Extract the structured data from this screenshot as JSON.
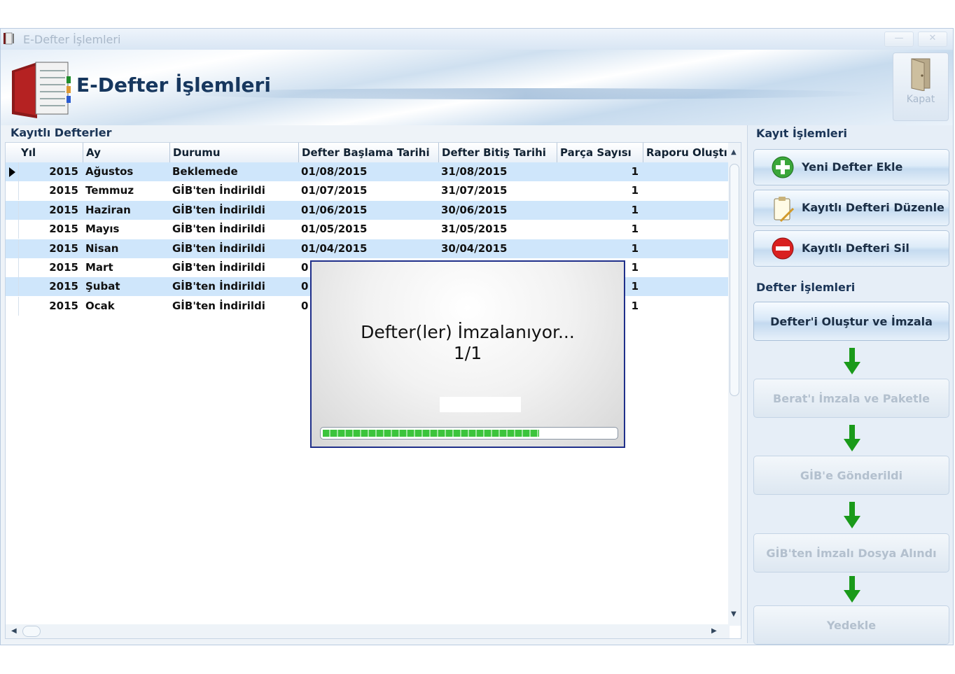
{
  "window": {
    "title": "E-Defter İşlemleri"
  },
  "banner": {
    "title": "E-Defter İşlemleri",
    "close_label": "Kapat"
  },
  "grid": {
    "section_title": "Kayıtlı Defterler",
    "columns": [
      "Yıl",
      "Ay",
      "Durumu",
      "Defter Başlama Tarihi",
      "Defter Bitiş Tarihi",
      "Parça Sayısı",
      "Raporu Oluştı"
    ],
    "rows": [
      [
        "2015",
        "Ağustos",
        "Beklemede",
        "01/08/2015",
        "31/08/2015",
        "1",
        ""
      ],
      [
        "2015",
        "Temmuz",
        "GİB'ten İndirildi",
        "01/07/2015",
        "31/07/2015",
        "1",
        ""
      ],
      [
        "2015",
        "Haziran",
        "GİB'ten İndirildi",
        "01/06/2015",
        "30/06/2015",
        "1",
        ""
      ],
      [
        "2015",
        "Mayıs",
        "GİB'ten İndirildi",
        "01/05/2015",
        "31/05/2015",
        "1",
        ""
      ],
      [
        "2015",
        "Nisan",
        "GİB'ten İndirildi",
        "01/04/2015",
        "30/04/2015",
        "1",
        ""
      ],
      [
        "2015",
        "Mart",
        "GİB'ten İndirildi",
        "0",
        "",
        "1",
        ""
      ],
      [
        "2015",
        "Şubat",
        "GİB'ten İndirildi",
        "0",
        "",
        "1",
        ""
      ],
      [
        "2015",
        "Ocak",
        "GİB'ten İndirildi",
        "0",
        "",
        "1",
        ""
      ]
    ],
    "selected_row": 0
  },
  "record_ops": {
    "title": "Kayıt İşlemleri",
    "add": "Yeni Defter Ekle",
    "edit": "Kayıtlı Defteri Düzenle",
    "delete": "Kayıtlı Defteri Sil"
  },
  "ledger_ops": {
    "title": "Defter İşlemleri",
    "steps": [
      "Defter'i Oluştur ve İmzala",
      "Berat'ı İmzala ve Paketle",
      "GİB'e Gönderildi",
      "GİB'ten İmzalı Dosya Alındı",
      "Yedekle"
    ],
    "active_step": 0
  },
  "dialog": {
    "message": "Defter(ler) İmzalanıyor...",
    "counter": "1/1",
    "progress": 0.74
  },
  "colors": {
    "row_alt": "#cfe6fb",
    "progress": "#3cc43c",
    "arrow": "#1a9a1a",
    "dialog_border": "#1f2f8a"
  }
}
